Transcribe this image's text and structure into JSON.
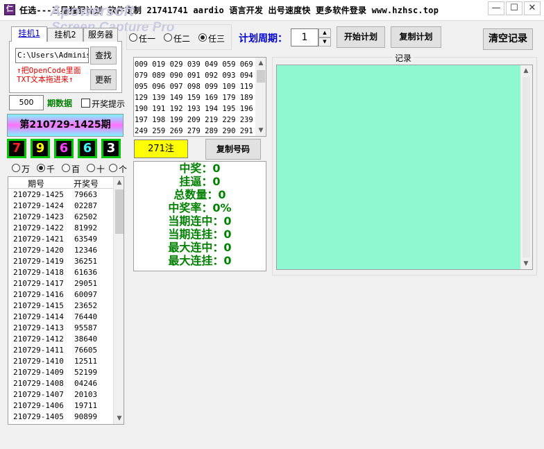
{
  "window": {
    "title": "任选---三星独胆计划  软件定制 21741741  aardio 语言开发  出号速度快  更多软件登录 www.hzhsc.top",
    "watermark_line1": "Apowersoft",
    "watermark_line2": "Screen Capture Pro",
    "icon_glyph": "仁",
    "min_glyph": "—",
    "max_glyph": "☐",
    "close_glyph": "✕"
  },
  "tabs": [
    {
      "label": "挂机1"
    },
    {
      "label": "挂机2"
    },
    {
      "label": "服务器"
    }
  ],
  "file": {
    "path_value": "C:\\Users\\Administ",
    "find_label": "查找",
    "update_label": "更新",
    "hint": "↑把OpenCode里面TXT文本拖进来↑"
  },
  "period": {
    "value": "500",
    "label": "期数据",
    "prize_alert_label": "开奖提示"
  },
  "issue": {
    "banner": "第210729-1425期",
    "digits": [
      {
        "value": "7",
        "color": "#ff2020"
      },
      {
        "value": "9",
        "color": "#ffff00"
      },
      {
        "value": "6",
        "color": "#ff40ff"
      },
      {
        "value": "6",
        "color": "#40ffff"
      },
      {
        "value": "3",
        "color": "#ffffff"
      }
    ]
  },
  "positions": [
    {
      "label": "万",
      "checked": false
    },
    {
      "label": "千",
      "checked": true
    },
    {
      "label": "百",
      "checked": false
    },
    {
      "label": "十",
      "checked": false
    },
    {
      "label": "个",
      "checked": false
    }
  ],
  "history": {
    "col_issue": "期号",
    "col_result": "开奖号",
    "rows": [
      [
        "210729-1425",
        "79663"
      ],
      [
        "210729-1424",
        "02287"
      ],
      [
        "210729-1423",
        "62502"
      ],
      [
        "210729-1422",
        "81992"
      ],
      [
        "210729-1421",
        "63549"
      ],
      [
        "210729-1420",
        "12346"
      ],
      [
        "210729-1419",
        "36251"
      ],
      [
        "210729-1418",
        "61636"
      ],
      [
        "210729-1417",
        "29051"
      ],
      [
        "210729-1416",
        "60097"
      ],
      [
        "210729-1415",
        "23652"
      ],
      [
        "210729-1414",
        "76440"
      ],
      [
        "210729-1413",
        "95587"
      ],
      [
        "210729-1412",
        "38640"
      ],
      [
        "210729-1411",
        "76605"
      ],
      [
        "210729-1410",
        "12511"
      ],
      [
        "210729-1409",
        "52199"
      ],
      [
        "210729-1408",
        "04246"
      ],
      [
        "210729-1407",
        "20103"
      ],
      [
        "210729-1406",
        "19711"
      ],
      [
        "210729-1405",
        "90899"
      ]
    ]
  },
  "modes": [
    {
      "label": "任一",
      "checked": false
    },
    {
      "label": "任二",
      "checked": false
    },
    {
      "label": "任三",
      "checked": true
    }
  ],
  "plan": {
    "label": "计划周期：",
    "value": "1",
    "start_label": "开始计划",
    "copy_label": "复制计划",
    "clear_label": "清空记录",
    "spin_up": "▲",
    "spin_down": "▼"
  },
  "numbers": {
    "text": "009 019 029 039 049 059 069\n079 089 090 091 092 093 094\n095 096 097 098 099 109 119\n129 139 149 159 169 179 189\n190 191 192 193 194 195 196\n197 198 199 209 219 229 239\n249 259 269 279 289 290 291",
    "count": "271注",
    "copy_label": "复制号码"
  },
  "stats": [
    "中奖：0",
    "挂逼：0",
    "总数量：0",
    "中奖率：0%",
    "当期连中：0",
    "当期连挂：0",
    "最大连中：0",
    "最大连挂：0"
  ],
  "record": {
    "label": "记录"
  },
  "scroll": {
    "up": "▲",
    "down": "▼"
  }
}
